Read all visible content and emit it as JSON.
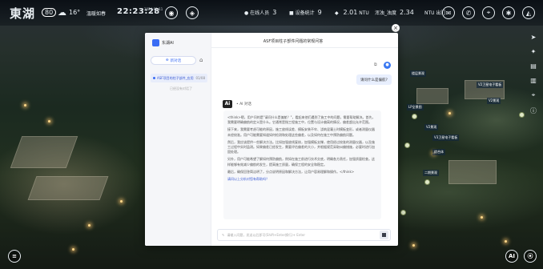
{
  "topbar": {
    "logo_text": "東湖",
    "logo_mark": "80",
    "weather_icon": "cloud-icon",
    "temperature": "16°",
    "place": "溫暖如春",
    "time": "22:23:28",
    "date": "2024-01-11",
    "stats": [
      {
        "label": "在线人员",
        "value": "3"
      },
      {
        "label": "设备统计",
        "value": "9"
      },
      {
        "label": "NTU",
        "value": "2.01"
      },
      {
        "label": "浑浊_浊度",
        "value": "2.34"
      },
      {
        "label": "NTU",
        "value": "出门"
      }
    ]
  },
  "map_labels": [
    "楼层景观",
    "LP全景图",
    "V2景观",
    "V2卫星电子看板",
    "V2景观",
    "V3卫星电子看板",
    "综合体",
    "二期景观"
  ],
  "modal": {
    "app_name": "东湖AI",
    "new_chat": "新对话",
    "history_item": "ASF项目的柱子部件_应用",
    "history_time": "01/08",
    "history_sub": "已经没有对话了",
    "chat_title": "ASF项目柱子部件问题的常规问答",
    "user_question": "请问什么是偏航?",
    "ai_label": "AI 对话",
    "answer_paragraphs": [
      "<think>嗯，用户问的是\"请问什么是偏航？\"，看起来他们遇到了施工中的问题，需要帮助解决。首先，我需要明确偏航的定义是什么。它通常是指工程施工中，位置与设计偏离的情况，偏差超出允许范围。",
      "接下来，我需要考虑可能的原因，施工放线误差、模板安装不牢、浇筑混凝土时模板变形，或者测量仪器未经校准。用户可能需要知道如何检测和处理这些偏差，以及如何在施工中预防偏航问题。",
      "然后，我应该提供一些解决方法。比如加强放线复核，加强模板支撑，使用经过校准的测量仪器，以及施工过程中实时监测。如果偏差已经发生，需要评估偏差的大小，并根据规范采取纠偏措施，必要时进行加固处理。",
      "另外，用户可能希望了解如何预防偏航，例如在施工前进行技术交底，明确各方责任，加强质量检查。这样能够有效减少偏航的发生，提高施工质量，确保工程的安全和稳定。",
      "最后，确保回答简洁明了，分点说明原因和解决方法，让用户容易理解和操作。</think>"
    ],
    "answer_followup": "请问以上分析对您有帮助吗？",
    "input_placeholder": "请输入问题，发送以后即可(Shift+Enter换行)+ Enter"
  },
  "corner": {
    "bottom_left_icon": "menu-icon",
    "bottom_right_ai": "AI"
  }
}
